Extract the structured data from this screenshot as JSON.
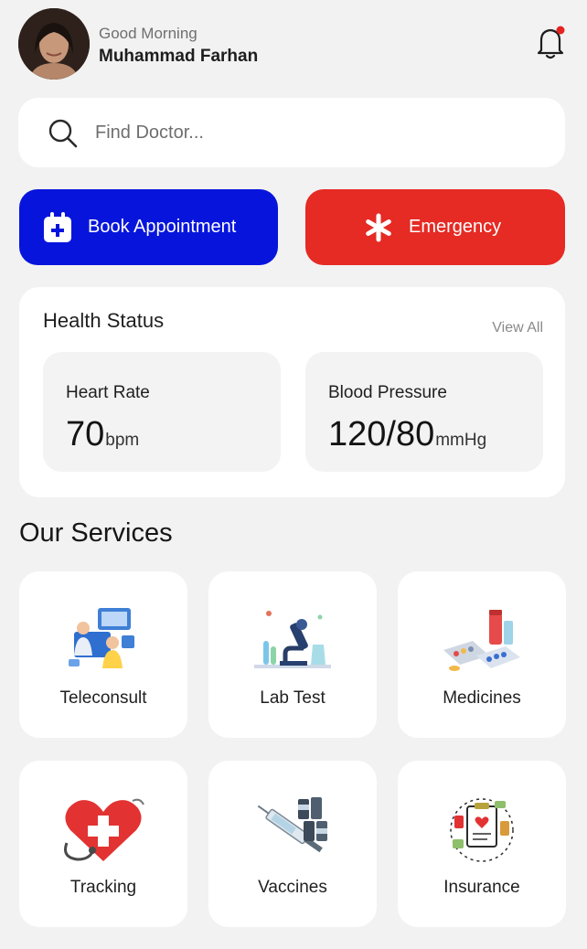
{
  "header": {
    "greeting": "Good Morning",
    "user_name": "Muhammad Farhan"
  },
  "search": {
    "placeholder": "Find Doctor..."
  },
  "actions": {
    "book_label": "Book Appointment",
    "emergency_label": "Emergency"
  },
  "health_status": {
    "title": "Health Status",
    "view_all": "View All",
    "heart_rate": {
      "label": "Heart Rate",
      "value": "70",
      "unit": "bpm"
    },
    "blood_pressure": {
      "label": "Blood Pressure",
      "value": "120/80",
      "unit": "mmHg"
    }
  },
  "services": {
    "title": "Our Services",
    "items": [
      {
        "label": "Teleconsult",
        "icon": "teleconsult-icon"
      },
      {
        "label": "Lab Test",
        "icon": "lab-test-icon"
      },
      {
        "label": "Medicines",
        "icon": "medicines-icon"
      },
      {
        "label": "Tracking",
        "icon": "tracking-icon"
      },
      {
        "label": "Vaccines",
        "icon": "vaccines-icon"
      },
      {
        "label": "Insurance",
        "icon": "insurance-icon"
      }
    ]
  },
  "colors": {
    "background": "#f2f2f2",
    "primary_blue": "#0715dc",
    "emergency_red": "#e62a24",
    "notification_dot": "#e52222"
  }
}
